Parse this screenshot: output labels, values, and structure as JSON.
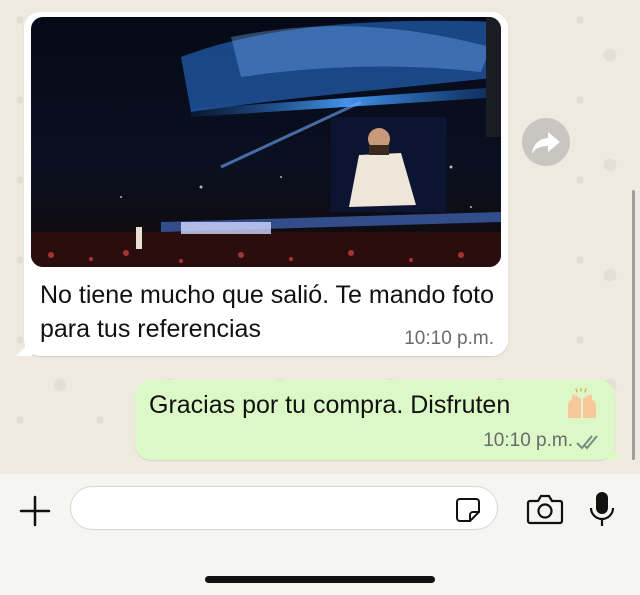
{
  "chat": {
    "incoming": {
      "image_alt": "concert photo",
      "text": "No tiene mucho que salió. Te mando foto para tus referencias",
      "time": "10:10 p.m."
    },
    "outgoing": {
      "text": "Gracias por tu compra. Disfruten",
      "emoji": "raising-hands-emoji",
      "time": "10:10 p.m.",
      "status": "read"
    }
  },
  "composer": {
    "placeholder": ""
  },
  "colors": {
    "incoming_bubble": "#ffffff",
    "outgoing_bubble": "#dcf8c6",
    "wallpaper": "#efe9e0"
  },
  "icons": [
    "forward-icon",
    "plus-icon",
    "sticker-icon",
    "camera-icon",
    "mic-icon",
    "double-check-icon"
  ]
}
